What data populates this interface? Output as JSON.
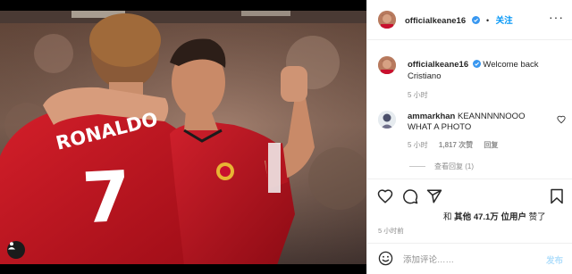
{
  "post": {
    "author": "officialkeane16",
    "follow_label": "关注",
    "separator": "•",
    "more_label": "···",
    "caption_text": "Welcome back Cristiano",
    "caption_time": "5 小时",
    "shirt_name": "RONALDO",
    "shirt_number": "7"
  },
  "comment": {
    "author": "ammarkhan",
    "text": "KEANNNNNOOO WHAT A PHOTO",
    "time": "5 小时",
    "likes": "1,817 次赞",
    "reply_label": "回复",
    "view_replies": "查看回复 (1)"
  },
  "likes": {
    "prefix": "和",
    "others": "其他",
    "count": "47.1万",
    "user_suffix": "位用户",
    "liked": "赞了"
  },
  "timestamp": "5 小时前",
  "composer": {
    "placeholder": "添加评论……",
    "post_label": "发布"
  },
  "icons": {
    "verified": "verified-badge-icon",
    "like": "heart-icon",
    "comment": "comment-bubble-icon",
    "share": "paper-plane-icon",
    "save": "bookmark-icon",
    "emoji": "emoji-smile-icon",
    "tag": "user-tag-icon"
  },
  "colors": {
    "link_blue": "#0095f6",
    "verified_blue": "#3897f0",
    "kit_red": "#c8102e",
    "muted_text": "#8e8e8e"
  }
}
